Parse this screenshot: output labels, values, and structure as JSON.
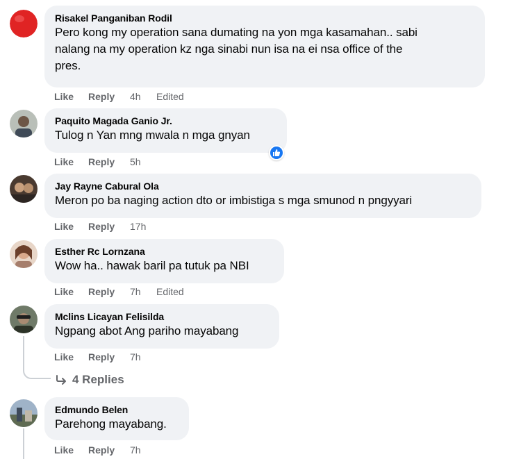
{
  "comments": [
    {
      "author": "Risakel Panganiban Rodil",
      "lines": [
        "Pero kong my operation sana dumating na yon mga kasamahan.. sabi",
        "nalang na my operation kz nga sinabi nun isa na ei nsa office of the",
        "pres."
      ],
      "like": "Like",
      "reply": "Reply",
      "time": "4h",
      "edited": "Edited",
      "avatar_color": "#e02424"
    },
    {
      "author": "Paquito Magada Ganio Jr.",
      "lines": [
        "Tulog n Yan mng mwala n mga gnyan"
      ],
      "like": "Like",
      "reply": "Reply",
      "time": "5h",
      "reaction": "like-reaction-icon",
      "avatar_color": "#8a8f8a"
    },
    {
      "author": "Jay Rayne Cabural Ola",
      "lines": [
        "Meron po ba naging action dto or imbistiga s mga smunod n pngyyari"
      ],
      "like": "Like",
      "reply": "Reply",
      "time": "17h",
      "avatar_color": "#5a4a3e"
    },
    {
      "author": "Esther Rc Lornzana",
      "lines": [
        "Wow ha.. hawak baril pa tutuk pa NBI"
      ],
      "like": "Like",
      "reply": "Reply",
      "time": "7h",
      "edited": "Edited",
      "avatar_color": "#c9a894"
    },
    {
      "author": "Mclins Licayan Felisilda",
      "lines": [
        "Ngpang abot Ang pariho mayabang"
      ],
      "like": "Like",
      "reply": "Reply",
      "time": "7h",
      "avatar_color": "#4f5b4a"
    },
    {
      "author": "Edmundo Belen",
      "lines": [
        "Parehong mayabang."
      ],
      "like": "Like",
      "reply": "Reply",
      "time": "7h",
      "avatar_color": "#7c8a9a"
    }
  ],
  "replies_link": {
    "label": "4 Replies",
    "icon": "reply-arrow-icon"
  },
  "colors": {
    "bubble": "#f0f2f5",
    "secondary_text": "#65676b",
    "reaction_blue": "#1877f2"
  }
}
